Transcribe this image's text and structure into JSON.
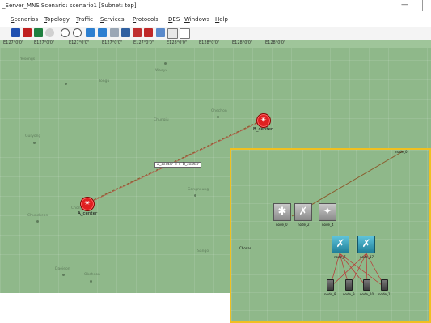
{
  "window": {
    "title": "_Server_MNS Scenario: scenario1  [Subnet: top]",
    "minimize_glyph": "—"
  },
  "menubar": {
    "items": [
      "Scenarios",
      "Topology",
      "Traffic",
      "Services",
      "Protocols",
      "DES",
      "Windows",
      "Help"
    ]
  },
  "toolbar": {
    "icons": [
      "new-scenario-icon",
      "save-icon",
      "open-icon",
      "info-icon",
      "zoom-in-icon",
      "zoom-out-icon",
      "link-icon",
      "link2-icon",
      "table-icon",
      "chart-icon",
      "arrow-icon",
      "run-icon",
      "image-icon",
      "pie-icon",
      "number-icon"
    ]
  },
  "map": {
    "coords": [
      "E127°0'0\"",
      "E127°0'0\"",
      "E127°0'0\"",
      "E127°0'0\"",
      "E127°0'0\"",
      "E128°0'0\"",
      "E128°0'0\"",
      "E128°0'0\"",
      "E128°0'0\""
    ],
    "cities": [
      "Yesongs",
      "Tongu",
      "Waeyu",
      "Chechon",
      "Chungju",
      "Guryong",
      "Chuncheon",
      "Chonju",
      "Gangneung",
      "Sango",
      "Daejeon",
      "Okcheon",
      "Chonan"
    ],
    "routers": {
      "a": {
        "label": "A_center"
      },
      "b": {
        "label": "B_center"
      }
    },
    "link_label": "A_center <-> B_center"
  },
  "inset": {
    "top_label": "node_0",
    "devices": {
      "server": "node_0",
      "switch1": "node_2",
      "switch2": "node_4",
      "core1": "node_7",
      "core2": "node_17",
      "pc1": "node_8",
      "pc2": "node_9",
      "pc3": "node_10",
      "pc4": "node_11"
    },
    "side_label": "Chonan"
  },
  "colors": {
    "map_green": "#8fb88a",
    "router_red": "#e02020",
    "inset_border": "#f0c020",
    "link_brown": "#8b5a2b",
    "device_teal": "#1f7f99"
  }
}
